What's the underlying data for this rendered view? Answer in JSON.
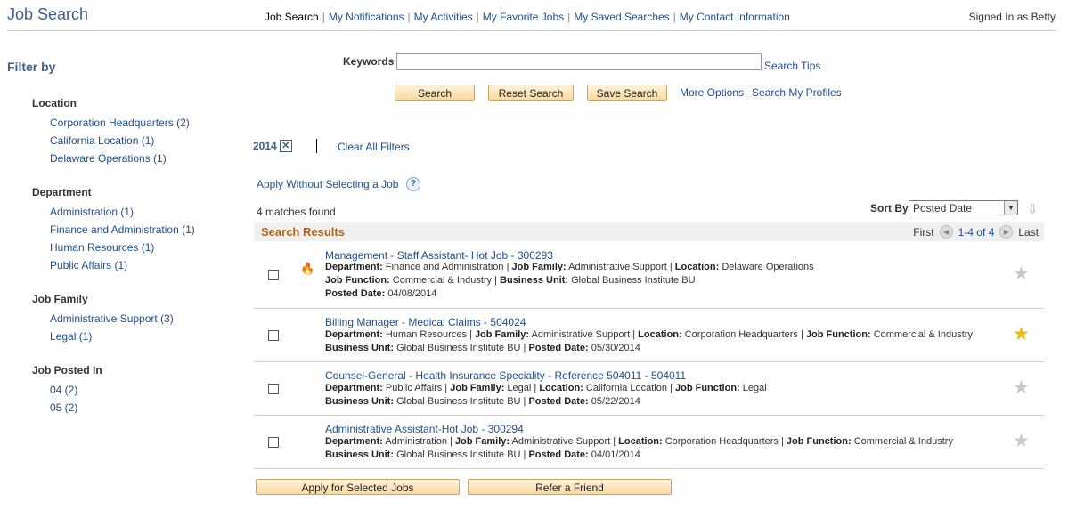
{
  "header": {
    "app_title": "Job Search",
    "nav": [
      "Job Search",
      "My Notifications",
      "My Activities",
      "My Favorite Jobs",
      "My Saved Searches",
      "My Contact Information"
    ],
    "signed_in": "Signed In as Betty"
  },
  "sidebar": {
    "title": "Filter by",
    "facets": [
      {
        "heading": "Location",
        "items": [
          "Corporation Headquarters (2)",
          "California Location (1)",
          "Delaware Operations (1)"
        ]
      },
      {
        "heading": "Department",
        "items": [
          "Administration (1)",
          "Finance and Administration (1)",
          "Human Resources (1)",
          "Public Affairs (1)"
        ]
      },
      {
        "heading": "Job Family",
        "items": [
          "Administrative Support (3)",
          "Legal (1)"
        ]
      },
      {
        "heading": "Job Posted In",
        "items": [
          "04 (2)",
          "05 (2)"
        ]
      }
    ]
  },
  "search": {
    "keywords_label": "Keywords",
    "keywords_value": "",
    "search_tips": "Search Tips",
    "search_button": "Search",
    "reset_button": "Reset Search",
    "save_button": "Save Search",
    "more_options": "More Options",
    "search_profiles": "Search My Profiles"
  },
  "filters": {
    "active_chip": "2014",
    "chip_remove_glyph": "✕",
    "clear_all": "Clear All Filters"
  },
  "apply_without": "Apply Without Selecting a Job",
  "help_glyph": "?",
  "matches": "4 matches found",
  "sort": {
    "label": "Sort By",
    "value": "Posted Date",
    "arrow_glyph": "▼",
    "dir_glyph": "⇩"
  },
  "results": {
    "title": "Search Results",
    "pager": {
      "first": "First",
      "prev_glyph": "◀",
      "count": "1-4 of 4",
      "next_glyph": "▶",
      "last": "Last"
    },
    "star_glyph": "★",
    "hot_glyph": "🔥",
    "labels": {
      "department": "Department:",
      "job_family": "Job Family:",
      "location": "Location:",
      "job_function": "Job Function:",
      "business_unit": "Business Unit:",
      "posted_date": "Posted Date:"
    },
    "rows": [
      {
        "title": "Management - Staff Assistant- Hot Job - 300293",
        "hot": true,
        "favorite": false,
        "department": "Finance and Administration",
        "job_family": "Administrative Support",
        "location": "Delaware Operations",
        "job_function": "Commercial & Industry",
        "business_unit": "Global Business Institute BU",
        "posted_date": "04/08/2014"
      },
      {
        "title": "Billing Manager - Medical Claims - 504024",
        "hot": false,
        "favorite": true,
        "department": "Human Resources",
        "job_family": "Administrative Support",
        "location": "Corporation Headquarters",
        "job_function": "Commercial & Industry",
        "business_unit": "Global Business Institute BU",
        "posted_date": "05/30/2014"
      },
      {
        "title": "Counsel-General - Health Insurance Speciality - Reference 504011 - 504011",
        "hot": false,
        "favorite": false,
        "department": "Public Affairs",
        "job_family": "Legal",
        "location": "California Location",
        "job_function": "Legal",
        "business_unit": "Global Business Institute BU",
        "posted_date": "05/22/2014"
      },
      {
        "title": "Administrative Assistant-Hot Job - 300294",
        "hot": false,
        "favorite": false,
        "department": "Administration",
        "job_family": "Administrative Support",
        "location": "Corporation Headquarters",
        "job_function": "Commercial & Industry",
        "business_unit": "Global Business Institute BU",
        "posted_date": "04/01/2014"
      }
    ]
  },
  "footer_buttons": {
    "apply_selected": "Apply for Selected Jobs",
    "refer": "Refer a Friend"
  }
}
